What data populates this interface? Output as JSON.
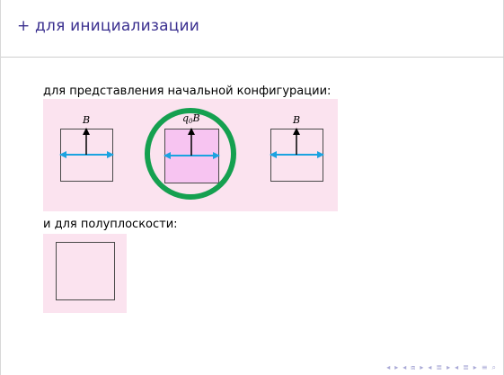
{
  "slide": {
    "title": "+ для инициализации",
    "caption_configuration": "для представления начальной конфигурации:",
    "caption_half_plane": "и для полуплоскости:"
  },
  "cells": [
    {
      "label_main": "B",
      "label_sub": "",
      "highlighted": false
    },
    {
      "label_main": "B",
      "label_sub": "0",
      "label_prefix": "q",
      "highlighted": true
    },
    {
      "label_main": "B",
      "label_sub": "",
      "highlighted": false
    }
  ],
  "colors": {
    "title": "#3a2f8f",
    "panel_background": "#fbe3ef",
    "highlight_fill": "#f7c4f1",
    "ring": "#15a050",
    "arrow_horizontal": "#1ba3e0",
    "arrow_vertical": "#000000"
  },
  "navigation": {
    "icons": [
      "prev-slide-icon",
      "next-slide-icon",
      "prev-frame-icon",
      "next-frame-icon",
      "prev-section-icon",
      "next-section-icon",
      "prev-subsection-icon",
      "next-subsection-icon",
      "align-icon",
      "search-icon"
    ]
  }
}
